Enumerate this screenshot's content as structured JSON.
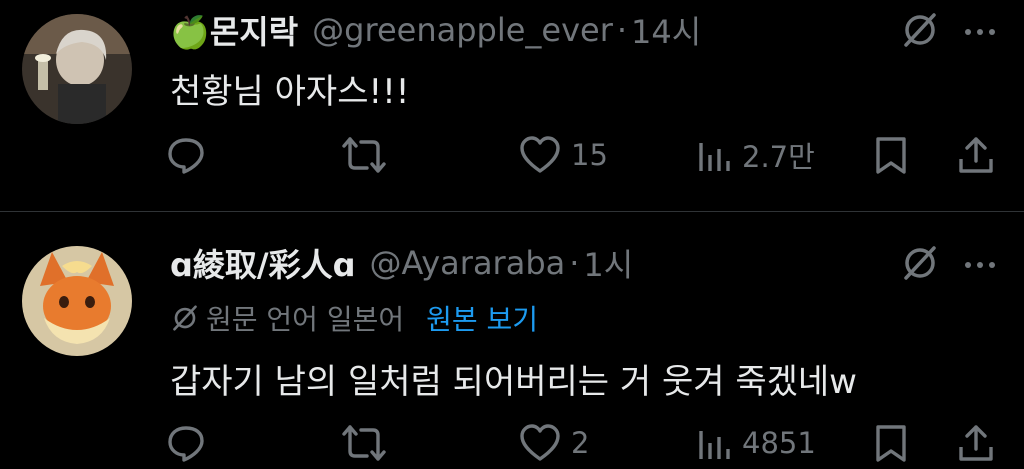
{
  "tweets": [
    {
      "avatar_icon": "person-photo-avatar",
      "name": "🍏몬지락",
      "handle": "@greenapple_ever",
      "separator": "·",
      "time": "14시",
      "text": "천황님 아자스!!!",
      "replies": "",
      "retweets": "",
      "likes": "15",
      "views": "2.7만"
    },
    {
      "avatar_icon": "flareon-avatar",
      "name": "ɑ綾取/彩人ɑ",
      "handle": "@Ayararaba",
      "separator": "·",
      "time": "1시",
      "translation_note": "원문 언어 일본어",
      "translation_link": "원본 보기",
      "text": "갑자기 남의 일처럼 되어버리는 거 웃겨 죽겠네w",
      "replies": "",
      "retweets": "",
      "likes": "2",
      "views": "4851"
    }
  ],
  "colors": {
    "background": "#000000",
    "text": "#e7e9ea",
    "secondary": "#71767b",
    "link": "#1d9bf0",
    "divider": "#2f3336"
  }
}
